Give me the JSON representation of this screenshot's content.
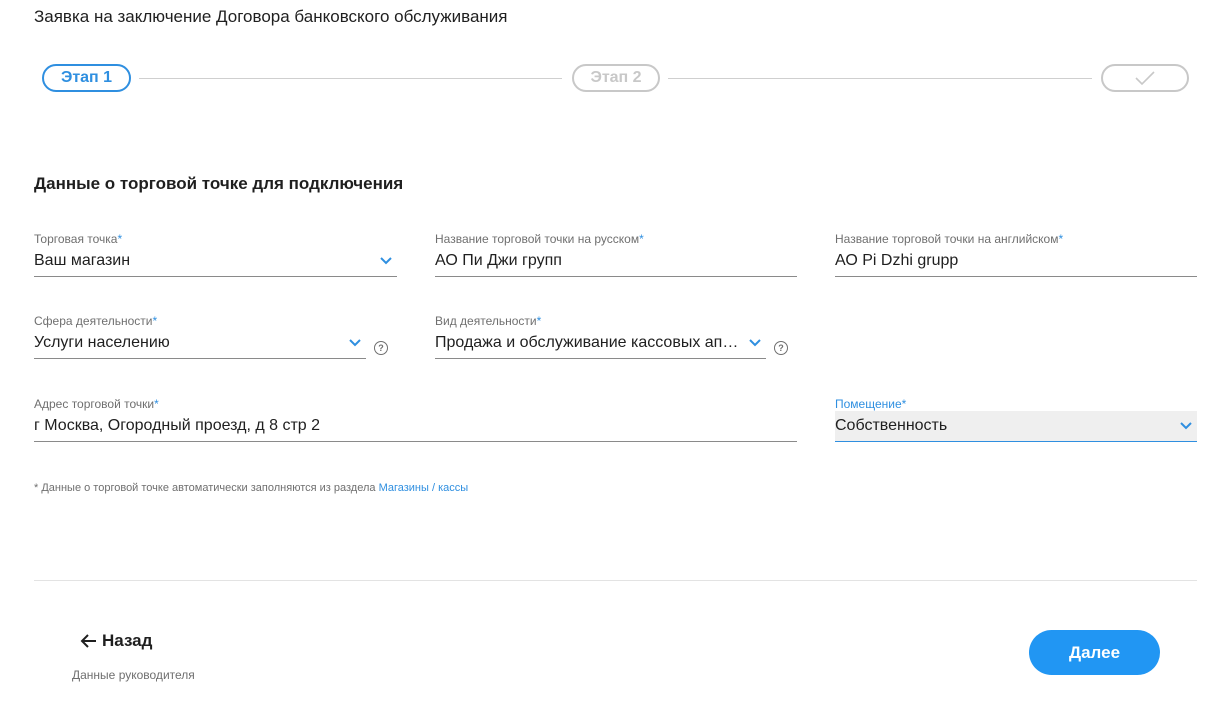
{
  "page": {
    "title": "Заявка на заключение Договора банковского обслуживания"
  },
  "stepper": {
    "step1": "Этап 1",
    "step2": "Этап 2",
    "step3_icon": "checkmark-icon"
  },
  "section": {
    "title": "Данные о торговой точке для подключения"
  },
  "form": {
    "required_mark": "*",
    "outlet": {
      "label": "Торговая точка",
      "value": "Ваш магазин"
    },
    "name_ru": {
      "label": "Название торговой точки на русском",
      "value": "АО Пи Джи групп"
    },
    "name_en": {
      "label": "Название торговой точки на английском",
      "value": "АО Pi Dzhi grupp"
    },
    "activity_sphere": {
      "label": "Сфера деятельности",
      "value": "Услуги населению"
    },
    "activity_type": {
      "label": "Вид деятельности",
      "value": "Продажа и обслуживание кассовых аппаратов"
    },
    "address": {
      "label": "Адрес торговой точки",
      "value": "г Москва, Огородный проезд, д 8 стр 2"
    },
    "premises": {
      "label": "Помещение",
      "value": "Собственность"
    },
    "help_glyph": "?"
  },
  "note": {
    "text": "* Данные о торговой точке автоматически заполняются из раздела ",
    "link": "Магазины / кассы"
  },
  "footer": {
    "back_label": "Назад",
    "back_sub": "Данные руководителя",
    "next_label": "Далее"
  },
  "colors": {
    "accent": "#2f8fe0",
    "button": "#2196f3",
    "inactive": "#c8c8c8"
  }
}
